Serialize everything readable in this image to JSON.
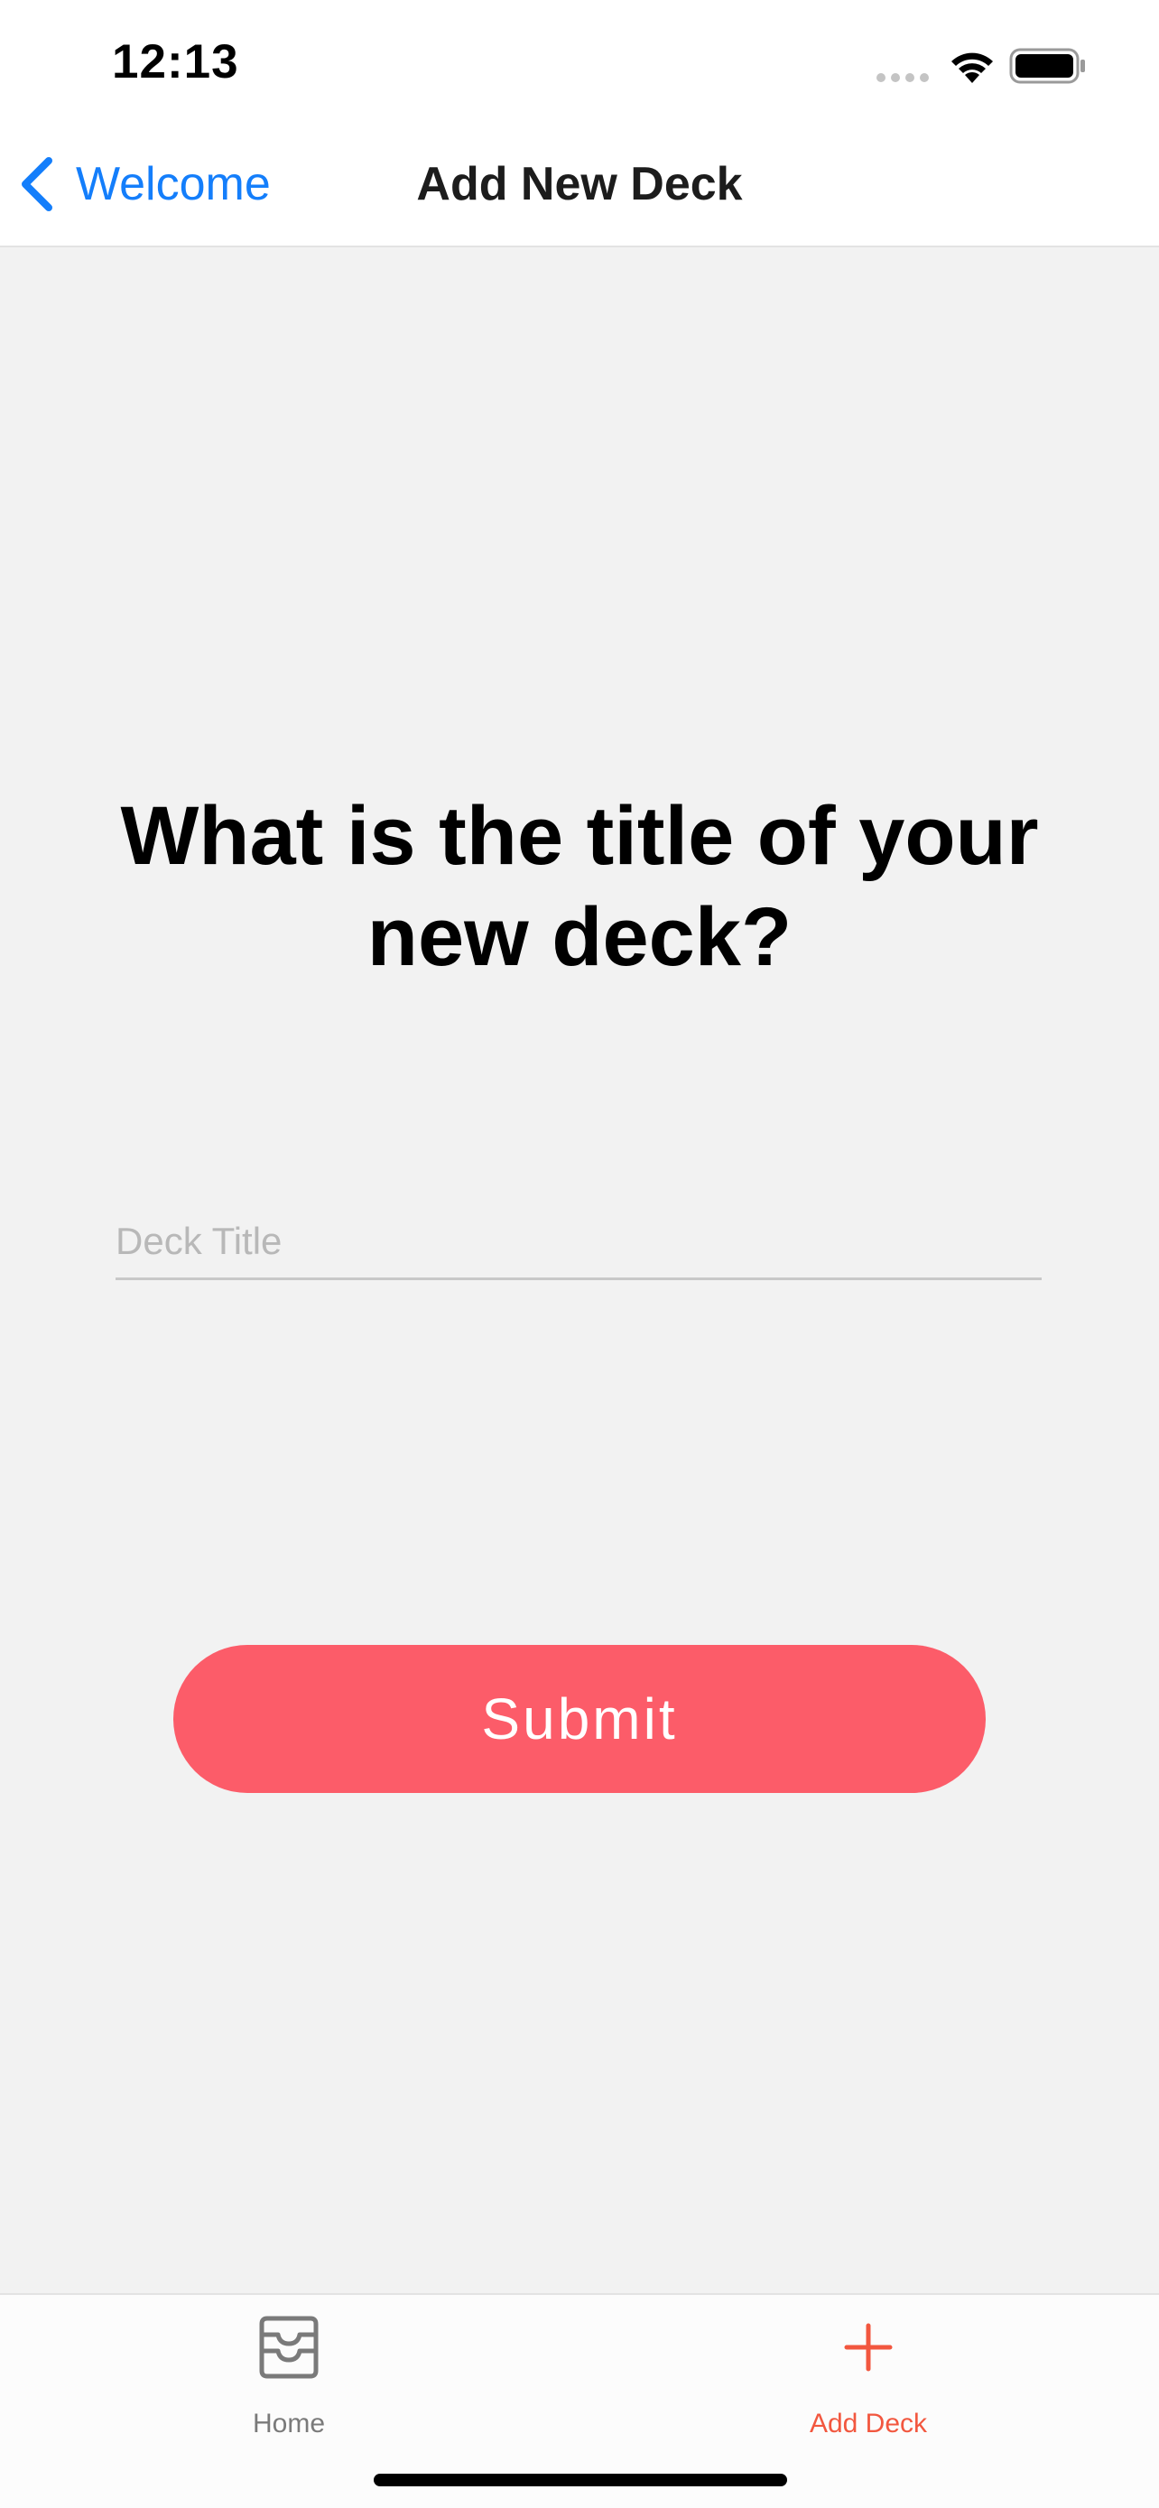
{
  "status_bar": {
    "time": "12:13"
  },
  "nav": {
    "back_label": "Welcome",
    "title": "Add New Deck"
  },
  "main": {
    "question": "What is the title of your new deck?",
    "deck_title_placeholder": "Deck Title",
    "deck_title_value": "",
    "submit_label": "Submit"
  },
  "tabs": [
    {
      "label": "Home",
      "icon": "inbox-icon",
      "active": false
    },
    {
      "label": "Add Deck",
      "icon": "plus-icon",
      "active": true
    }
  ],
  "colors": {
    "accent_blue": "#147efb",
    "submit_bg": "#fc5c69",
    "active_tab": "#f2573f",
    "inactive_tab": "#7a7a7a",
    "background": "#f2f2f2"
  }
}
